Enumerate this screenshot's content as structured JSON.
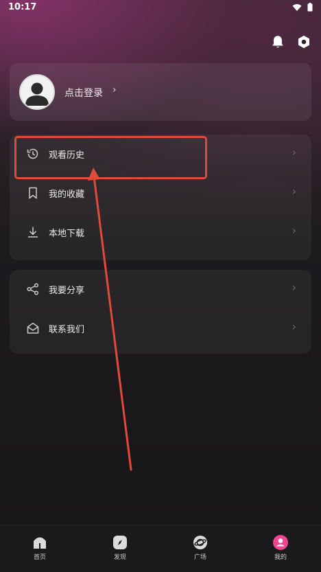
{
  "status": {
    "time": "10:17"
  },
  "header": {
    "notification_icon": "bell-icon",
    "settings_icon": "hexagon-settings-icon"
  },
  "login": {
    "label": "点击登录",
    "chevron": "›"
  },
  "menu_primary": [
    {
      "label": "观看历史",
      "icon": "history-icon"
    },
    {
      "label": "我的收藏",
      "icon": "bookmark-icon"
    },
    {
      "label": "本地下载",
      "icon": "download-icon"
    }
  ],
  "menu_secondary": [
    {
      "label": "我要分享",
      "icon": "share-icon"
    },
    {
      "label": "联系我们",
      "icon": "mail-icon"
    }
  ],
  "chevron": "›",
  "annotation": {
    "box_color": "#e24a3b",
    "arrow_color": "#e24a3b"
  },
  "bottom_nav": [
    {
      "label": "首页",
      "icon": "home-icon"
    },
    {
      "label": "发现",
      "icon": "compass-icon"
    },
    {
      "label": "广场",
      "icon": "planet-icon"
    },
    {
      "label": "我的",
      "icon": "profile-icon",
      "active": true,
      "accent": "#f0468f"
    }
  ]
}
